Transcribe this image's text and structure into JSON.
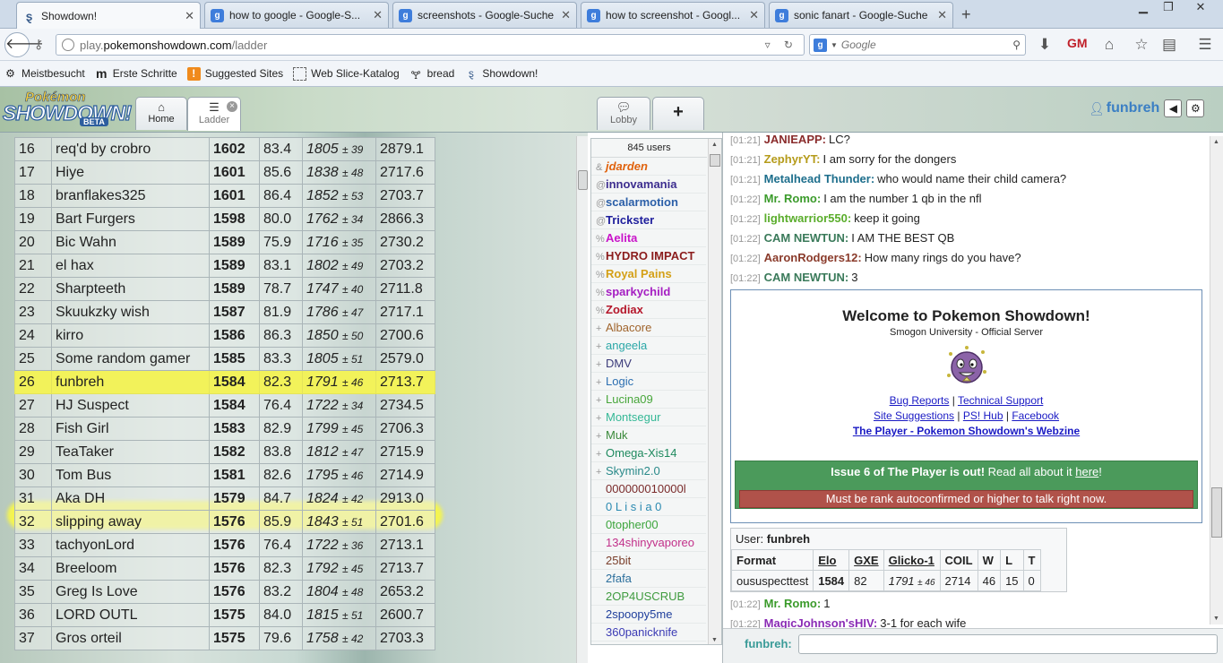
{
  "browser": {
    "tabs": [
      {
        "label": "Showdown!",
        "icon": "showdown-icon",
        "active": true
      },
      {
        "label": "how to google - Google-S...",
        "icon": "google-icon",
        "active": false
      },
      {
        "label": "screenshots - Google-Suche",
        "icon": "google-icon",
        "active": false
      },
      {
        "label": "how to screenshot - Googl...",
        "icon": "google-icon",
        "active": false
      },
      {
        "label": "sonic fanart - Google-Suche",
        "icon": "google-icon",
        "active": false
      }
    ],
    "new_tab_glyph": "+",
    "url_host": "play.pokemonshowdown.com",
    "url_path": "/ladder",
    "url_prefix": "play.",
    "url_domain": "pokemonshowdown.com",
    "search_placeholder": "Google",
    "bookmarks": [
      {
        "label": "Meistbesucht",
        "icon": "gear-icon"
      },
      {
        "label": "Erste Schritte",
        "icon": "m-icon"
      },
      {
        "label": "Suggested Sites",
        "icon": "suggested-sites-icon"
      },
      {
        "label": "Web Slice-Katalog",
        "icon": "web-slice-icon"
      },
      {
        "label": "bread",
        "icon": "bread-icon"
      },
      {
        "label": "Showdown!",
        "icon": "showdown-icon"
      }
    ]
  },
  "showdown": {
    "logo_top": "Pokémon",
    "logo_main": "SHOWDOWN!",
    "logo_badge": "BETA",
    "home_label": "Home",
    "ladder_label": "Ladder",
    "lobby_label": "Lobby",
    "add_tab_glyph": "+",
    "username": "funbreh"
  },
  "ladder": {
    "rows": [
      {
        "rank": "16",
        "name": "req'd by crobro",
        "elo": "1602",
        "gxe": "83.4",
        "glicko": "1805",
        "dev": "± 39",
        "coil": "2879.1"
      },
      {
        "rank": "17",
        "name": "Hiye",
        "elo": "1601",
        "gxe": "85.6",
        "glicko": "1838",
        "dev": "± 48",
        "coil": "2717.6"
      },
      {
        "rank": "18",
        "name": "branflakes325",
        "elo": "1601",
        "gxe": "86.4",
        "glicko": "1852",
        "dev": "± 53",
        "coil": "2703.7"
      },
      {
        "rank": "19",
        "name": "Bart Furgers",
        "elo": "1598",
        "gxe": "80.0",
        "glicko": "1762",
        "dev": "± 34",
        "coil": "2866.3"
      },
      {
        "rank": "20",
        "name": "Bic Wahn",
        "elo": "1589",
        "gxe": "75.9",
        "glicko": "1716",
        "dev": "± 35",
        "coil": "2730.2"
      },
      {
        "rank": "21",
        "name": "el hax",
        "elo": "1589",
        "gxe": "83.1",
        "glicko": "1802",
        "dev": "± 49",
        "coil": "2703.2"
      },
      {
        "rank": "22",
        "name": "Sharpteeth",
        "elo": "1589",
        "gxe": "78.7",
        "glicko": "1747",
        "dev": "± 40",
        "coil": "2711.8"
      },
      {
        "rank": "23",
        "name": "Skuukzky wish",
        "elo": "1587",
        "gxe": "81.9",
        "glicko": "1786",
        "dev": "± 47",
        "coil": "2717.1"
      },
      {
        "rank": "24",
        "name": "kirro",
        "elo": "1586",
        "gxe": "86.3",
        "glicko": "1850",
        "dev": "± 50",
        "coil": "2700.6"
      },
      {
        "rank": "25",
        "name": "Some random gamer",
        "elo": "1585",
        "gxe": "83.3",
        "glicko": "1805",
        "dev": "± 51",
        "coil": "2579.0"
      },
      {
        "rank": "26",
        "name": "funbreh",
        "elo": "1584",
        "gxe": "82.3",
        "glicko": "1791",
        "dev": "± 46",
        "coil": "2713.7",
        "highlight": true
      },
      {
        "rank": "27",
        "name": "HJ Suspect",
        "elo": "1584",
        "gxe": "76.4",
        "glicko": "1722",
        "dev": "± 34",
        "coil": "2734.5"
      },
      {
        "rank": "28",
        "name": "Fish Girl",
        "elo": "1583",
        "gxe": "82.9",
        "glicko": "1799",
        "dev": "± 45",
        "coil": "2706.3"
      },
      {
        "rank": "29",
        "name": "TeaTaker",
        "elo": "1582",
        "gxe": "83.8",
        "glicko": "1812",
        "dev": "± 47",
        "coil": "2715.9"
      },
      {
        "rank": "30",
        "name": "Tom Bus",
        "elo": "1581",
        "gxe": "82.6",
        "glicko": "1795",
        "dev": "± 46",
        "coil": "2714.9"
      },
      {
        "rank": "31",
        "name": "Aka DH",
        "elo": "1579",
        "gxe": "84.7",
        "glicko": "1824",
        "dev": "± 42",
        "coil": "2913.0"
      },
      {
        "rank": "32",
        "name": "slipping away",
        "elo": "1576",
        "gxe": "85.9",
        "glicko": "1843",
        "dev": "± 51",
        "coil": "2701.6"
      },
      {
        "rank": "33",
        "name": "tachyonLord",
        "elo": "1576",
        "gxe": "76.4",
        "glicko": "1722",
        "dev": "± 36",
        "coil": "2713.1"
      },
      {
        "rank": "34",
        "name": "Breeloom",
        "elo": "1576",
        "gxe": "82.3",
        "glicko": "1792",
        "dev": "± 45",
        "coil": "2713.7"
      },
      {
        "rank": "35",
        "name": "Greg Is Love",
        "elo": "1576",
        "gxe": "83.2",
        "glicko": "1804",
        "dev": "± 48",
        "coil": "2653.2"
      },
      {
        "rank": "36",
        "name": "LORD OUTL",
        "elo": "1575",
        "gxe": "84.0",
        "glicko": "1815",
        "dev": "± 51",
        "coil": "2600.7"
      },
      {
        "rank": "37",
        "name": "Gros orteil",
        "elo": "1575",
        "gxe": "79.6",
        "glicko": "1758",
        "dev": "± 42",
        "coil": "2703.3"
      }
    ]
  },
  "userlist": {
    "count": "845 users",
    "users": [
      {
        "sym": "&",
        "name": "jdarden",
        "color": "#e0620d",
        "italic": true,
        "bold": true
      },
      {
        "sym": "@",
        "name": "innovamania",
        "color": "#3d2e8f",
        "bold": true
      },
      {
        "sym": "@",
        "name": "scalarmotion",
        "color": "#2b5fa8",
        "bold": true
      },
      {
        "sym": "@",
        "name": "Trickster",
        "color": "#1e1e9c",
        "bold": true
      },
      {
        "sym": "%",
        "name": "Aelita",
        "color": "#c914c9",
        "bold": true
      },
      {
        "sym": "%",
        "name": "HYDRO IMPACT",
        "color": "#8b1d1d",
        "bold": true
      },
      {
        "sym": "%",
        "name": "Royal Pains",
        "color": "#d4a017",
        "bold": true
      },
      {
        "sym": "%",
        "name": "sparkychild",
        "color": "#a51ec2",
        "bold": true
      },
      {
        "sym": "%",
        "name": "Zodiax",
        "color": "#b5172b",
        "bold": true
      },
      {
        "sym": "+",
        "name": "Albacore",
        "color": "#a0642c",
        "bold": false
      },
      {
        "sym": "+",
        "name": "angeela",
        "color": "#2ba7a7",
        "bold": false
      },
      {
        "sym": "+",
        "name": "DMV",
        "color": "#3b3b7a",
        "bold": false
      },
      {
        "sym": "+",
        "name": "Logic",
        "color": "#2c6fb1",
        "bold": false
      },
      {
        "sym": "+",
        "name": "Lucina09",
        "color": "#47a63a",
        "bold": false
      },
      {
        "sym": "+",
        "name": "Montsegur",
        "color": "#35b896",
        "bold": false
      },
      {
        "sym": "+",
        "name": "Muk",
        "color": "#3b8a3b",
        "bold": false
      },
      {
        "sym": "+",
        "name": "Omega-Xis14",
        "color": "#1f8a5f",
        "bold": false
      },
      {
        "sym": "+",
        "name": "Skymin2.0",
        "color": "#2a8a8a",
        "bold": false
      },
      {
        "sym": "",
        "name": "000000010000l",
        "color": "#7a2b2b",
        "bold": false
      },
      {
        "sym": "",
        "name": "0 L i s i a 0",
        "color": "#2b8ab1",
        "bold": false
      },
      {
        "sym": "",
        "name": "0topher00",
        "color": "#3ca53c",
        "bold": false
      },
      {
        "sym": "",
        "name": "134shinyvaporeo",
        "color": "#c2318a",
        "bold": false
      },
      {
        "sym": "",
        "name": "25bit",
        "color": "#7a3f2b",
        "bold": false
      },
      {
        "sym": "",
        "name": "2fafa",
        "color": "#2c6f9c",
        "bold": false
      },
      {
        "sym": "",
        "name": "2OP4USCRUB",
        "color": "#3f9b3f",
        "bold": false
      },
      {
        "sym": "",
        "name": "2spoopy5me",
        "color": "#1f3f9c",
        "bold": false
      },
      {
        "sym": "",
        "name": "360panicknife",
        "color": "#3b3bb5",
        "bold": false
      }
    ]
  },
  "chat": {
    "lines": [
      {
        "ts": "[01:21]",
        "user": "JANIEAPP:",
        "text": "LC?",
        "color": "#8a2b2b"
      },
      {
        "ts": "[01:21]",
        "user": "ZephyrYT:",
        "text": "I am sorry for the dongers",
        "color": "#b59b1a"
      },
      {
        "ts": "[01:21]",
        "user": "Metalhead Thunder:",
        "text": "who would name their child camera?",
        "color": "#1d6e8c"
      },
      {
        "ts": "[01:22]",
        "user": "Mr. Romo:",
        "text": "I am the number 1 qb in the nfl",
        "color": "#3b9b2b"
      },
      {
        "ts": "[01:22]",
        "user": "lightwarrior550:",
        "text": "keep it going",
        "color": "#5aad2b"
      },
      {
        "ts": "[01:22]",
        "user": "CAM NEWTUN:",
        "text": "I AM THE BEST QB",
        "color": "#3a7a5a"
      },
      {
        "ts": "[01:22]",
        "user": "AaronRodgers12:",
        "text": "How many rings do you have?",
        "color": "#8a3b2b"
      },
      {
        "ts": "[01:22]",
        "user": "CAM NEWTUN:",
        "text": "3",
        "color": "#3a7a5a"
      }
    ],
    "welcome": {
      "title": "Welcome to Pokemon Showdown!",
      "subtitle": "Smogon University - Official Server",
      "bug_reports": "Bug Reports",
      "sep": "|",
      "tech_support": "Technical Support",
      "site_suggestions": "Site Suggestions",
      "ps_hub": "PS! Hub",
      "facebook": "Facebook",
      "webzine": "The Player - Pokemon Showdown's Webzine",
      "issue_bold": "Issue 6 of The Player is out!",
      "issue_text": " Read all about it ",
      "issue_link": "here",
      "issue_end": "!",
      "rank_msg": "Must be rank autoconfirmed or higher to talk right now."
    },
    "userbox": {
      "label": "User:",
      "name": "funbreh",
      "headers": [
        "Format",
        "Elo",
        "GXE",
        "Glicko-1",
        "COIL",
        "W",
        "L",
        "T"
      ],
      "format": "oususpecttest",
      "elo": "1584",
      "gxe": "82",
      "glicko": "1791",
      "dev": "± 46",
      "coil": "2714",
      "w": "46",
      "l": "15",
      "t": "0"
    },
    "after_lines": [
      {
        "ts": "[01:22]",
        "user": "Mr. Romo:",
        "text": "1",
        "color": "#3b9b2b"
      },
      {
        "ts": "[01:22]",
        "user": "MagicJohnson'sHIV:",
        "text": "3-1 for each wife",
        "color": "#8a2bb5"
      }
    ],
    "composer_name": "funbreh:"
  }
}
